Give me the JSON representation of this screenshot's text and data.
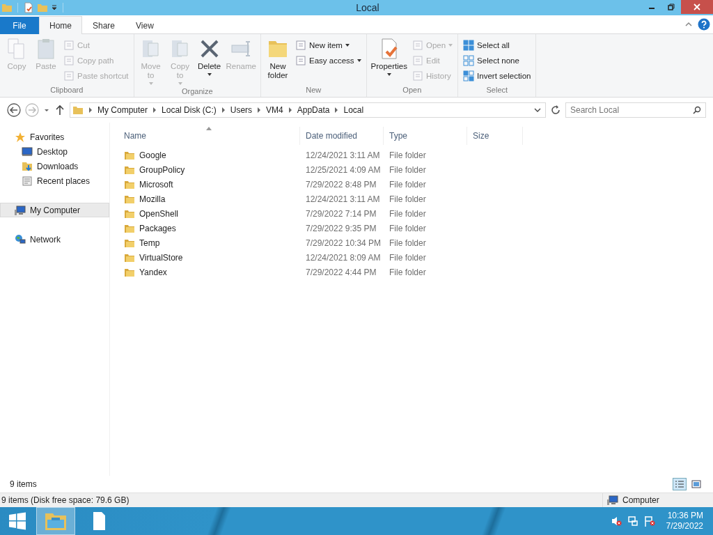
{
  "window": {
    "title": "Local"
  },
  "ribbon_tabs": [
    {
      "label": "File",
      "kind": "file",
      "selected": false
    },
    {
      "label": "Home",
      "kind": "tab",
      "selected": true
    },
    {
      "label": "Share",
      "kind": "tab",
      "selected": false
    },
    {
      "label": "View",
      "kind": "tab",
      "selected": false
    }
  ],
  "ribbon_groups": [
    {
      "name": "Clipboard",
      "items": [
        {
          "label": "Copy",
          "kind": "large",
          "disabled": true,
          "dropdown": false
        },
        {
          "label": "Paste",
          "kind": "large",
          "disabled": true,
          "dropdown": false
        },
        {
          "kind": "stack",
          "items": [
            {
              "label": "Cut",
              "disabled": true,
              "dropdown": false
            },
            {
              "label": "Copy path",
              "disabled": true,
              "dropdown": false
            },
            {
              "label": "Paste shortcut",
              "disabled": true,
              "dropdown": false
            }
          ]
        }
      ]
    },
    {
      "name": "Organize",
      "items": [
        {
          "label": "Move to",
          "kind": "large",
          "disabled": true,
          "dropdown": true
        },
        {
          "label": "Copy to",
          "kind": "large",
          "disabled": true,
          "dropdown": true
        },
        {
          "label": "Delete",
          "kind": "large",
          "disabled": false,
          "dropdown": true
        },
        {
          "label": "Rename",
          "kind": "large",
          "disabled": true,
          "dropdown": false
        }
      ]
    },
    {
      "name": "New",
      "items": [
        {
          "label": "New folder",
          "kind": "large",
          "disabled": false,
          "dropdown": false
        },
        {
          "kind": "stack",
          "items": [
            {
              "label": "New item",
              "disabled": false,
              "dropdown": true
            },
            {
              "label": "Easy access",
              "disabled": false,
              "dropdown": true
            }
          ]
        }
      ]
    },
    {
      "name": "Open",
      "items": [
        {
          "label": "Properties",
          "kind": "large",
          "disabled": false,
          "dropdown": true
        },
        {
          "kind": "stack",
          "items": [
            {
              "label": "Open",
              "disabled": true,
              "dropdown": true
            },
            {
              "label": "Edit",
              "disabled": true,
              "dropdown": false
            },
            {
              "label": "History",
              "disabled": true,
              "dropdown": false
            }
          ]
        }
      ]
    },
    {
      "name": "Select",
      "items": [
        {
          "kind": "stack",
          "items": [
            {
              "label": "Select all",
              "disabled": false,
              "dropdown": false
            },
            {
              "label": "Select none",
              "disabled": false,
              "dropdown": false
            },
            {
              "label": "Invert selection",
              "disabled": false,
              "dropdown": false
            }
          ]
        }
      ]
    }
  ],
  "address": {
    "crumbs": [
      "My Computer",
      "Local Disk (C:)",
      "Users",
      "VM4",
      "AppData",
      "Local"
    ]
  },
  "search": {
    "placeholder": "Search Local"
  },
  "nav": [
    {
      "label": "Favorites",
      "selected": false,
      "children": [
        {
          "label": "Desktop",
          "selected": false
        },
        {
          "label": "Downloads",
          "selected": false
        },
        {
          "label": "Recent places",
          "selected": false
        }
      ]
    },
    {
      "label": "My Computer",
      "selected": true
    },
    {
      "label": "Network",
      "selected": false
    }
  ],
  "columns": [
    "Name",
    "Date modified",
    "Type",
    "Size"
  ],
  "files": [
    {
      "name": "Google",
      "date": "12/24/2021 3:11 AM",
      "type": "File folder"
    },
    {
      "name": "GroupPolicy",
      "date": "12/25/2021 4:09 AM",
      "type": "File folder"
    },
    {
      "name": "Microsoft",
      "date": "7/29/2022 8:48 PM",
      "type": "File folder"
    },
    {
      "name": "Mozilla",
      "date": "12/24/2021 3:11 AM",
      "type": "File folder"
    },
    {
      "name": "OpenShell",
      "date": "7/29/2022 7:14 PM",
      "type": "File folder"
    },
    {
      "name": "Packages",
      "date": "7/29/2022 9:35 PM",
      "type": "File folder"
    },
    {
      "name": "Temp",
      "date": "7/29/2022 10:34 PM",
      "type": "File folder"
    },
    {
      "name": "VirtualStore",
      "date": "12/24/2021 8:09 AM",
      "type": "File folder"
    },
    {
      "name": "Yandex",
      "date": "7/29/2022 4:44 PM",
      "type": "File folder"
    }
  ],
  "item_count": "9 items",
  "status_bar": {
    "left": "9 items (Disk free space: 79.6 GB)",
    "right": "Computer"
  },
  "taskbar": {
    "apps": [
      {
        "kind": "explorer",
        "selected": true
      },
      {
        "kind": "document",
        "selected": false
      }
    ],
    "time": "10:36 PM",
    "date": "7/29/2022"
  }
}
